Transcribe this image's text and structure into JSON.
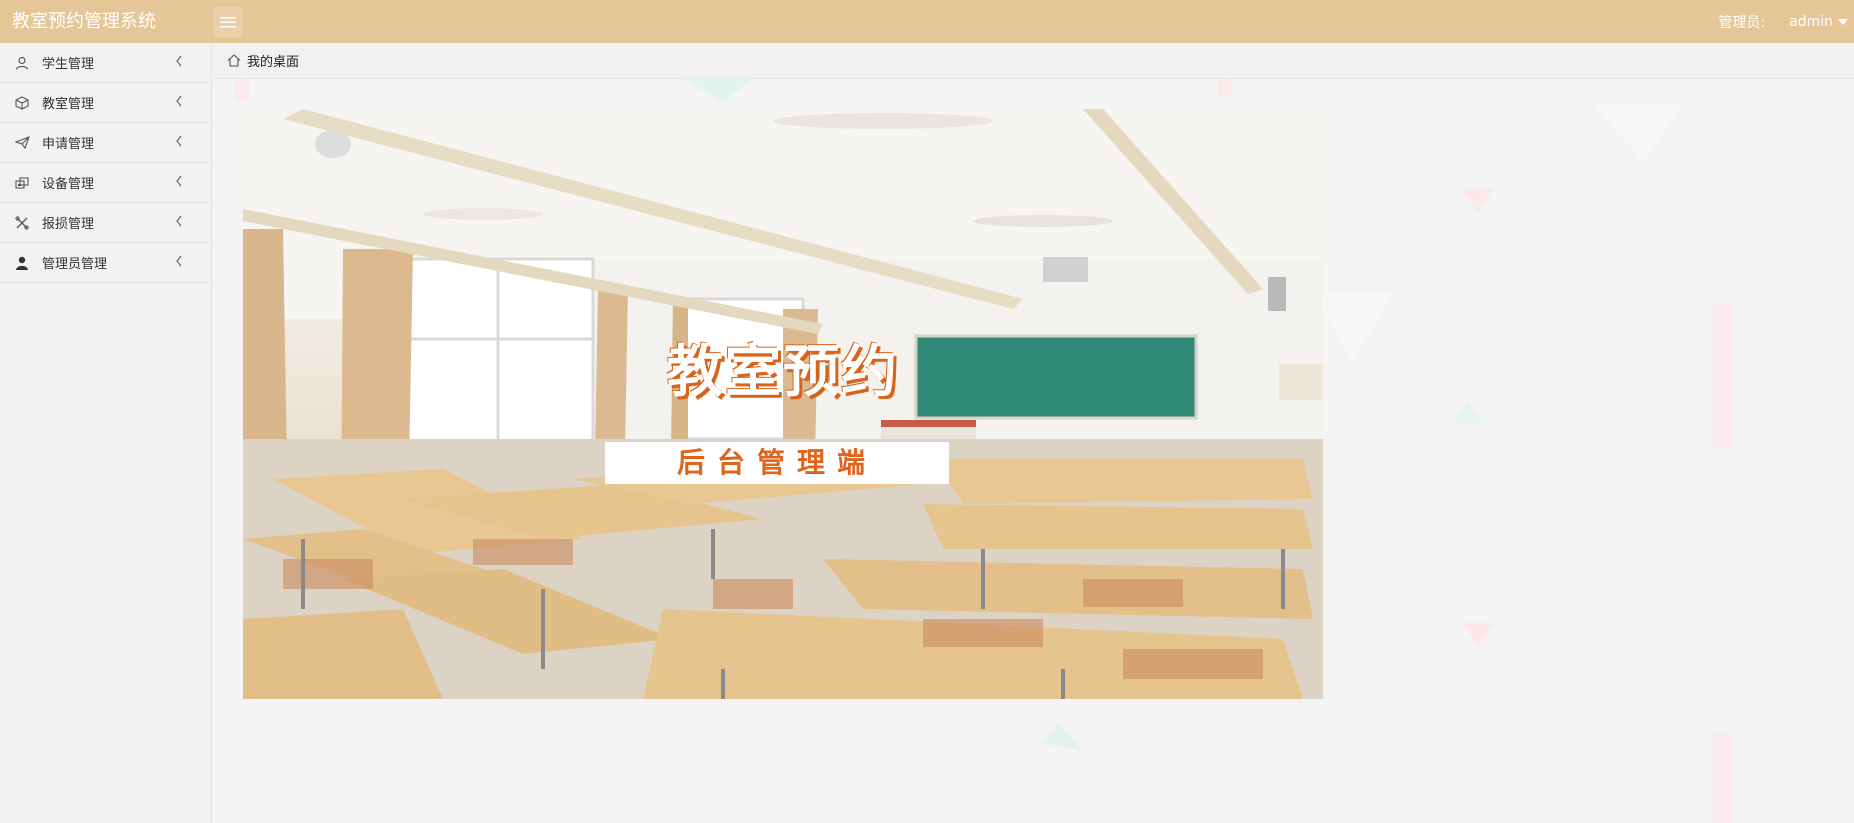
{
  "app": {
    "title": "教室预约管理系统"
  },
  "header": {
    "admin_label": "管理员:",
    "admin_name": "admin"
  },
  "sidebar": {
    "items": [
      {
        "label": "学生管理",
        "icon": "user-icon"
      },
      {
        "label": "教室管理",
        "icon": "cube-icon"
      },
      {
        "label": "申请管理",
        "icon": "paper-plane-icon"
      },
      {
        "label": "设备管理",
        "icon": "device-icon"
      },
      {
        "label": "报损管理",
        "icon": "tools-icon"
      },
      {
        "label": "管理员管理",
        "icon": "admin-icon"
      }
    ]
  },
  "breadcrumb": {
    "label": "我的桌面"
  },
  "banner": {
    "title": "教室预约",
    "subtitle": "后台管理端"
  },
  "colors": {
    "header": "#e5c697",
    "accent": "#e0641b"
  }
}
